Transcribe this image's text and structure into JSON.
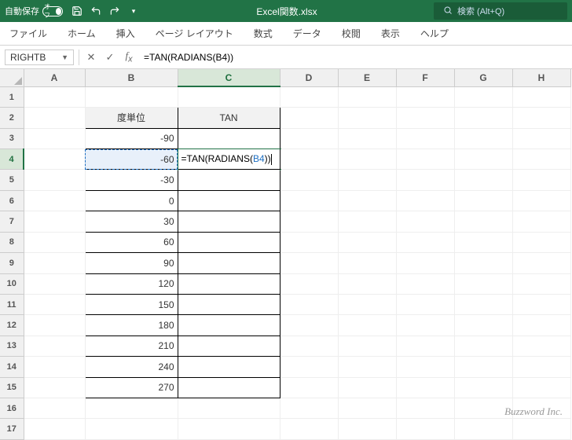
{
  "titlebar": {
    "autosave_label": "自動保存",
    "toggle_text": "オフ",
    "filename": "Excel関数.xlsx",
    "search_placeholder": "検索 (Alt+Q)"
  },
  "ribbon": {
    "tabs": [
      "ファイル",
      "ホーム",
      "挿入",
      "ページ レイアウト",
      "数式",
      "データ",
      "校閲",
      "表示",
      "ヘルプ"
    ]
  },
  "formula_bar": {
    "name_box": "RIGHTB",
    "formula": "=TAN(RADIANS(B4))"
  },
  "columns": [
    "A",
    "B",
    "C",
    "D",
    "E",
    "F",
    "G",
    "H"
  ],
  "rows": [
    1,
    2,
    3,
    4,
    5,
    6,
    7,
    8,
    9,
    10,
    11,
    12,
    13,
    14,
    15,
    16,
    17
  ],
  "active_row": 4,
  "active_col": "C",
  "sheet": {
    "header_b": "度単位",
    "header_c": "TAN",
    "b_values": [
      "-90",
      "-60",
      "-30",
      "0",
      "30",
      "60",
      "90",
      "120",
      "150",
      "180",
      "210",
      "240",
      "270"
    ],
    "edit_prefix": "=TAN(RADIANS(",
    "edit_ref": "B4",
    "edit_suffix": "))"
  },
  "watermark": "Buzzword Inc."
}
